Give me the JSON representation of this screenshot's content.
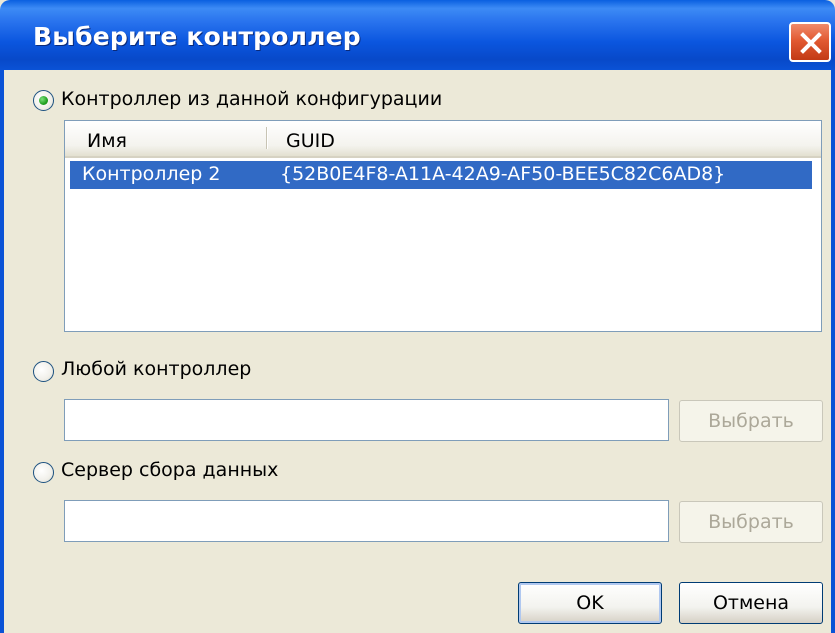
{
  "dialog": {
    "title": "Выберите контроллер",
    "close_icon": "close-icon"
  },
  "options": {
    "from_config": {
      "label": "Контроллер из данной конфигурации",
      "selected": true
    },
    "any_controller": {
      "label": "Любой контроллер",
      "selected": false,
      "field_value": "",
      "button_label": "Выбрать"
    },
    "data_server": {
      "label": "Сервер сбора данных",
      "selected": false,
      "field_value": "",
      "button_label": "Выбрать"
    }
  },
  "list": {
    "columns": [
      "Имя",
      "GUID"
    ],
    "rows": [
      {
        "name": "Контроллер 2",
        "guid": "{52B0E4F8-A11A-42A9-AF50-BEE5C82C6AD8}",
        "selected": true
      }
    ]
  },
  "buttons": {
    "ok_label": "OK",
    "cancel_label": "Отмена"
  },
  "colors": {
    "titlebar": "#0a52d6",
    "selection": "#316ac5",
    "window_bg": "#ece9d8",
    "close_button": "#e25a32"
  }
}
